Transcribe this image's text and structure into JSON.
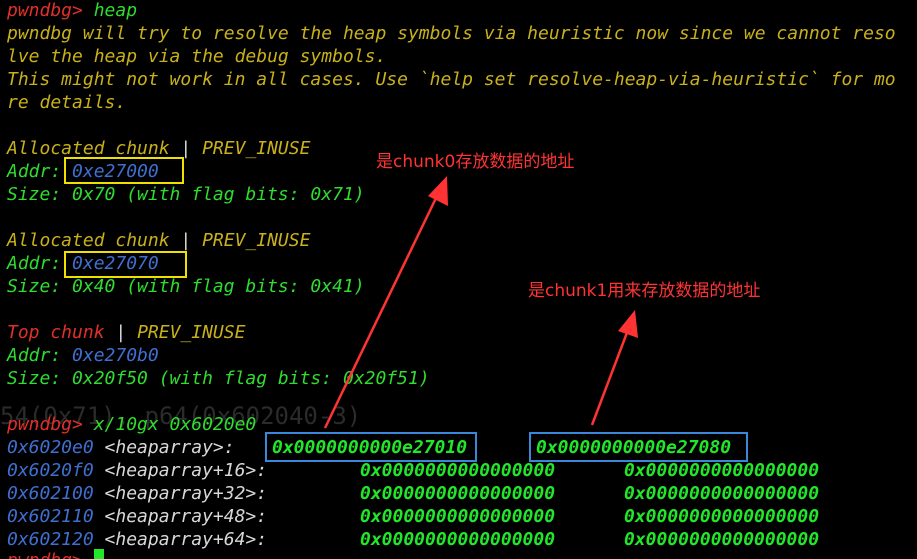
{
  "terminal": {
    "prompt": "pwndbg>",
    "command_heap": "heap",
    "warning_line1": "pwndbg will try to resolve the heap symbols via heuristic now since we cannot reso",
    "warning_line2": "lve the heap via the debug symbols.",
    "warning_line3": "This might not work in all cases. Use `help set resolve-heap-via-heuristic` for mo",
    "warning_line4": "re details.",
    "chunk1": {
      "type": "Allocated chunk",
      "sep": " | ",
      "flag": "PREV_INUSE",
      "addr_label": "Addr:",
      "addr": "0xe27000",
      "size_line": "Size: 0x70 (with flag bits: 0x71)"
    },
    "chunk2": {
      "type": "Allocated chunk",
      "sep": " | ",
      "flag": "PREV_INUSE",
      "addr_label": "Addr:",
      "addr": "0xe27070",
      "size_line": "Size: 0x40 (with flag bits: 0x41)"
    },
    "chunk3": {
      "type": "Top chunk",
      "sep": " | ",
      "flag": "PREV_INUSE",
      "addr_label": "Addr:",
      "addr": "0xe270b0",
      "size_line": "Size: 0x20f50 (with flag bits: 0x20f51)"
    },
    "ghost_text": "54(0x71), p64(0x602040-3)",
    "command_x": "x/10gx 0x6020e0",
    "memory_rows": [
      {
        "addr": "0x6020e0",
        "sym": "<heaparray>:",
        "v1": "0x0000000000e27010",
        "v2": "0x0000000000e27080"
      },
      {
        "addr": "0x6020f0",
        "sym": "<heaparray+16>:",
        "v1": "0x0000000000000000",
        "v2": "0x0000000000000000"
      },
      {
        "addr": "0x602100",
        "sym": "<heaparray+32>:",
        "v1": "0x0000000000000000",
        "v2": "0x0000000000000000"
      },
      {
        "addr": "0x602110",
        "sym": "<heaparray+48>:",
        "v1": "0x0000000000000000",
        "v2": "0x0000000000000000"
      },
      {
        "addr": "0x602120",
        "sym": "<heaparray+64>:",
        "v1": "0x0000000000000000",
        "v2": "0x0000000000000000"
      }
    ],
    "last_prompt": "pwndbg>"
  },
  "annotations": {
    "chunk0_note": "是chunk0存放数据的地址",
    "chunk1_note": "是chunk1用来存放数据的地址"
  },
  "colors": {
    "prompt": "#e0302a",
    "yellow": "#c9b11b",
    "green": "#2fdc2f",
    "blue": "#3f6fd0",
    "annotation": "#ff3333",
    "highlight_box_yellow": "#f0e000",
    "highlight_box_blue": "#3a86d8"
  }
}
